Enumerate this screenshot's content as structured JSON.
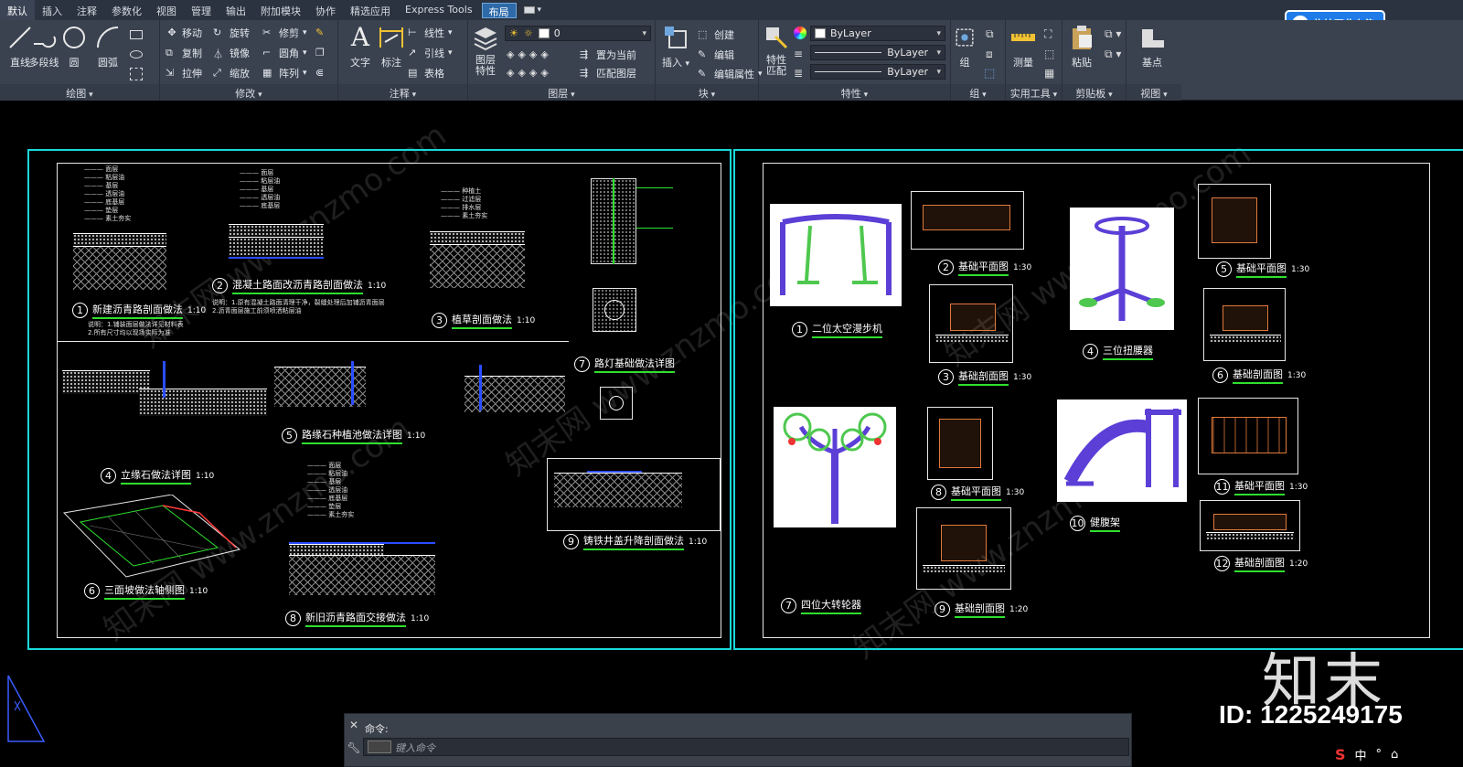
{
  "tabs": [
    "默认",
    "插入",
    "注释",
    "参数化",
    "视图",
    "管理",
    "输出",
    "附加模块",
    "协作",
    "精选应用",
    "Express Tools",
    "布局"
  ],
  "upload_button": "拖拽至此上传",
  "panels": {
    "draw": {
      "title": "绘图",
      "big": [
        "直线",
        "多段线",
        "圆",
        "圆弧"
      ]
    },
    "modify": {
      "title": "修改",
      "items": [
        "移动",
        "旋转",
        "修剪",
        "复制",
        "镜像",
        "圆角",
        "拉伸",
        "缩放",
        "阵列"
      ]
    },
    "annotation": {
      "title": "注释",
      "big": [
        "文字",
        "标注"
      ],
      "items": [
        "线性",
        "引线",
        "表格"
      ]
    },
    "layers": {
      "title": "图层",
      "big": "图层特性",
      "layer_value": "0",
      "items": [
        "置为当前",
        "匹配图层"
      ]
    },
    "block": {
      "title": "块",
      "big": "插入",
      "items": [
        "创建",
        "编辑",
        "编辑属性"
      ]
    },
    "properties": {
      "title": "特性",
      "big": "特性匹配",
      "color": "ByLayer",
      "linetype": "ByLayer",
      "lineweight": "ByLayer"
    },
    "group": {
      "title": "组",
      "big": "组"
    },
    "utilities": {
      "title": "实用工具",
      "big": "测量"
    },
    "clipboard": {
      "title": "剪贴板",
      "big": "粘贴"
    },
    "view": {
      "title": "视图",
      "big": "基点"
    }
  },
  "left_sheet": {
    "details": [
      {
        "num": "1",
        "title": "新建沥青路剖面做法",
        "scale": "1:10"
      },
      {
        "num": "2",
        "title": "混凝土路面改沥青路剖面做法",
        "scale": "1:10"
      },
      {
        "num": "3",
        "title": "植草剖面做法",
        "scale": "1:10"
      },
      {
        "num": "4",
        "title": "立缘石做法详图",
        "scale": "1:10"
      },
      {
        "num": "5",
        "title": "路缘石种植池做法详图",
        "scale": "1:10"
      },
      {
        "num": "6",
        "title": "三面坡做法轴侧图",
        "scale": "1:10"
      },
      {
        "num": "7",
        "title": "路灯基础做法详图",
        "scale": ""
      },
      {
        "num": "8",
        "title": "新旧沥青路面交接做法",
        "scale": "1:10"
      },
      {
        "num": "9",
        "title": "铸铁井盖升降剖面做法",
        "scale": "1:10"
      }
    ],
    "note_lines": [
      "说明：1.铺装面层做法详见材料表",
      "2.所有尺寸均以现场实际为准"
    ]
  },
  "right_sheet": {
    "details": [
      {
        "num": "1",
        "title": "二位太空漫步机",
        "scale": ""
      },
      {
        "num": "2",
        "title": "基础平面图",
        "scale": "1:30"
      },
      {
        "num": "3",
        "title": "基础剖面图",
        "scale": "1:30"
      },
      {
        "num": "4",
        "title": "三位扭腰器",
        "scale": ""
      },
      {
        "num": "5",
        "title": "基础平面图",
        "scale": "1:30"
      },
      {
        "num": "6",
        "title": "基础剖面图",
        "scale": "1:30"
      },
      {
        "num": "7",
        "title": "四位大转轮器",
        "scale": ""
      },
      {
        "num": "8",
        "title": "基础平面图",
        "scale": "1:30"
      },
      {
        "num": "9",
        "title": "基础剖面图",
        "scale": "1:20"
      },
      {
        "num": "10",
        "title": "健腹架",
        "scale": ""
      },
      {
        "num": "11",
        "title": "基础平面图",
        "scale": "1:30"
      },
      {
        "num": "12",
        "title": "基础剖面图",
        "scale": "1:20"
      }
    ]
  },
  "watermark": "知末网 www.znzmo.com",
  "logo_text": "知末",
  "id_text": "ID: 1225249175",
  "command": {
    "history": "命令:",
    "placeholder": "键入命令"
  },
  "tray": [
    "中",
    "°",
    "⌂"
  ],
  "colors": {
    "sheet_border": "#19d9d9",
    "title_underline": "#2ee02e",
    "ribbon_bg": "#3a4250",
    "tab_active": "#2f6aa8",
    "upload_blue": "#1e7be8"
  }
}
